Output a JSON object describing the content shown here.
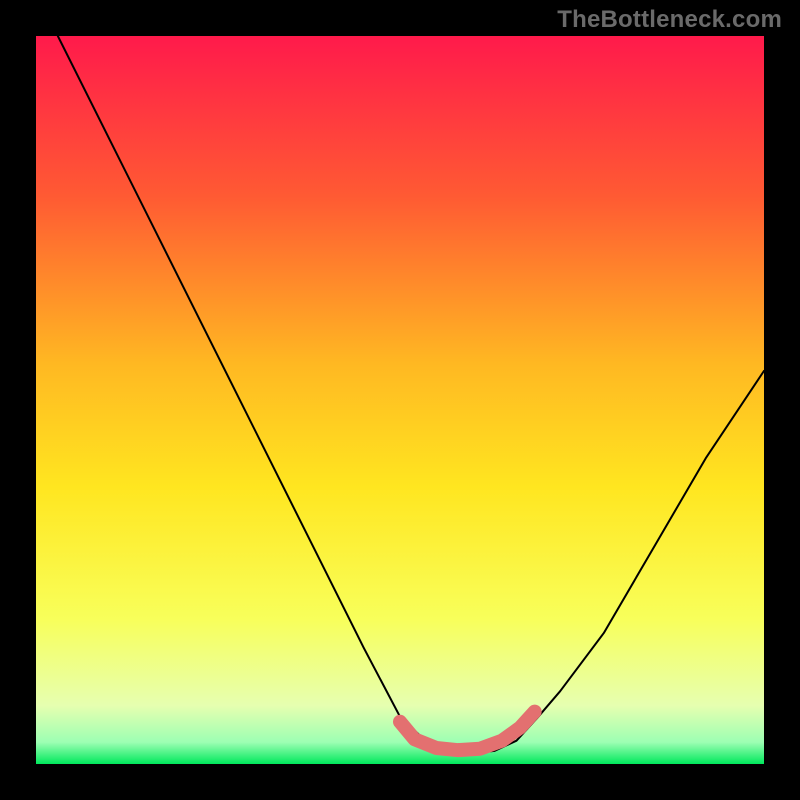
{
  "watermark": "TheBottleneck.com",
  "chart_data": {
    "type": "line",
    "title": "",
    "xlabel": "",
    "ylabel": "",
    "xlim": [
      0,
      100
    ],
    "ylim": [
      0,
      100
    ],
    "grid": false,
    "legend": false,
    "gradient_stops": [
      {
        "offset": 0.0,
        "color": "#ff1a4b"
      },
      {
        "offset": 0.22,
        "color": "#ff5a33"
      },
      {
        "offset": 0.45,
        "color": "#ffb822"
      },
      {
        "offset": 0.62,
        "color": "#ffe620"
      },
      {
        "offset": 0.8,
        "color": "#f8ff5a"
      },
      {
        "offset": 0.92,
        "color": "#e6ffb0"
      },
      {
        "offset": 0.97,
        "color": "#9dffb3"
      },
      {
        "offset": 1.0,
        "color": "#00e85c"
      }
    ],
    "series": [
      {
        "name": "bottleneck-curve",
        "color": "#000000",
        "x": [
          3,
          10,
          17,
          24,
          31,
          38,
          45,
          50,
          53.5,
          57,
          60,
          63,
          66,
          69,
          72,
          78,
          85,
          92,
          100
        ],
        "values": [
          100,
          86,
          72,
          58,
          44,
          30,
          16,
          6.5,
          3.2,
          1.8,
          1.5,
          1.8,
          3.2,
          6.5,
          10,
          18,
          30,
          42,
          54
        ]
      },
      {
        "name": "optimal-zone",
        "color": "#e37070",
        "x": [
          50,
          52,
          55,
          58,
          61,
          64,
          66.5,
          68.5
        ],
        "values": [
          5.8,
          3.4,
          2.2,
          1.9,
          2.1,
          3.2,
          5.0,
          7.2
        ]
      }
    ]
  }
}
